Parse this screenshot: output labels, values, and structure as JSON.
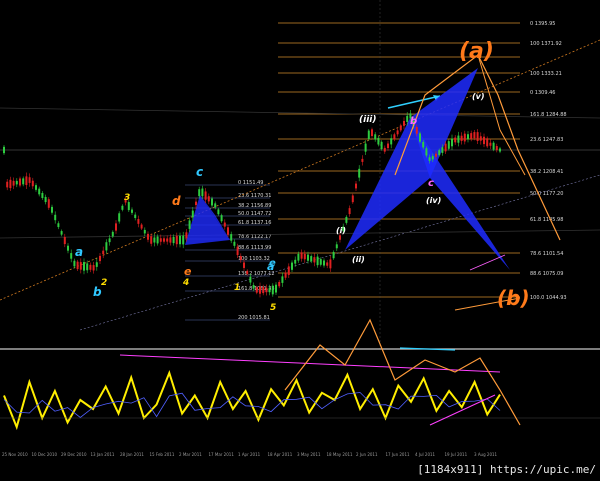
{
  "watermark": "[1184x911] https://upic.me/",
  "colors": {
    "background": "#000000",
    "candle_up": "#2ecc40",
    "candle_down": "#e02020",
    "fib_line": "#d08a2a",
    "harmonic_fill": "#1f2cff",
    "oscillator": "#ffee00",
    "projection": "#ff8c3a",
    "count_label": "#ff7a1a"
  },
  "chart_data": [
    {
      "type": "candlestick",
      "panel": "price",
      "title": "",
      "fib_levels": [
        {
          "label": "0 1395.95",
          "price": 1395.95
        },
        {
          "label": "100 1371.92",
          "price": 1371.92
        },
        {
          "label": "",
          "price": 1352.2
        },
        {
          "label": "100 1333.21",
          "price": 1333.21
        },
        {
          "label": "0 1309.46",
          "price": 1309.46
        },
        {
          "label": "161.8 1284.88",
          "price": 1284.88
        },
        {
          "label": "23.6 1247.83",
          "price": 1247.83
        },
        {
          "label": "38.2 1208.41",
          "price": 1208.41
        },
        {
          "label": "50.0 1177.20",
          "price": 1177.2
        },
        {
          "label": "61.8 1145.98",
          "price": 1145.98
        },
        {
          "label": "78.6 1101.54",
          "price": 1101.54
        },
        {
          "label": "88.6 1075.09",
          "price": 1075.09
        },
        {
          "label": "100.0 1044.93",
          "price": 1044.93
        }
      ],
      "fib_small": [
        {
          "label": "0 1151.49"
        },
        {
          "label": "23.6 1170.31"
        },
        {
          "label": "38.2 1156.89"
        },
        {
          "label": "50.0 1147.72"
        },
        {
          "label": "61.8 1137.16"
        },
        {
          "label": "78.6 1122.17"
        },
        {
          "label": "88.6 1113.99"
        },
        {
          "label": "100 1103.32"
        },
        {
          "label": "138.2 1077.12"
        },
        {
          "label": "161.8 1061.33"
        },
        {
          "label": "200 1015.81"
        }
      ],
      "wave_labels": [
        "(a)",
        "(b)",
        "(iii)",
        "(iv)",
        "(ii)",
        "(i)",
        "(v)",
        "c",
        "a",
        "b",
        "d",
        "e",
        "1",
        "2",
        "3",
        "4",
        "5"
      ]
    },
    {
      "type": "line",
      "panel": "oscillator",
      "series": [
        {
          "values": [
            55,
            20,
            70,
            30,
            60,
            25,
            50,
            40,
            65,
            35,
            75,
            30,
            45,
            80,
            35,
            55,
            30,
            70,
            40,
            60,
            28,
            62,
            44,
            72,
            36,
            58,
            50,
            78,
            40,
            62,
            30,
            66,
            48,
            74,
            38,
            60,
            42,
            70,
            34,
            56
          ]
        }
      ]
    }
  ],
  "x_dates": [
    "25 Nov 2010",
    "10 Dec 2010",
    "29 Dec 2010",
    "13 Jan 2011",
    "28 Jan 2011",
    "15 Feb 2011",
    "2 Mar 2011",
    "17 Mar 2011",
    "1 Apr 2011",
    "18 Apr 2011",
    "3 May 2011",
    "18 May 2011",
    "2 Jun 2011",
    "17 Jun 2011",
    "4 Jul 2011",
    "19 Jul 2011",
    "3 Aug 2011"
  ]
}
